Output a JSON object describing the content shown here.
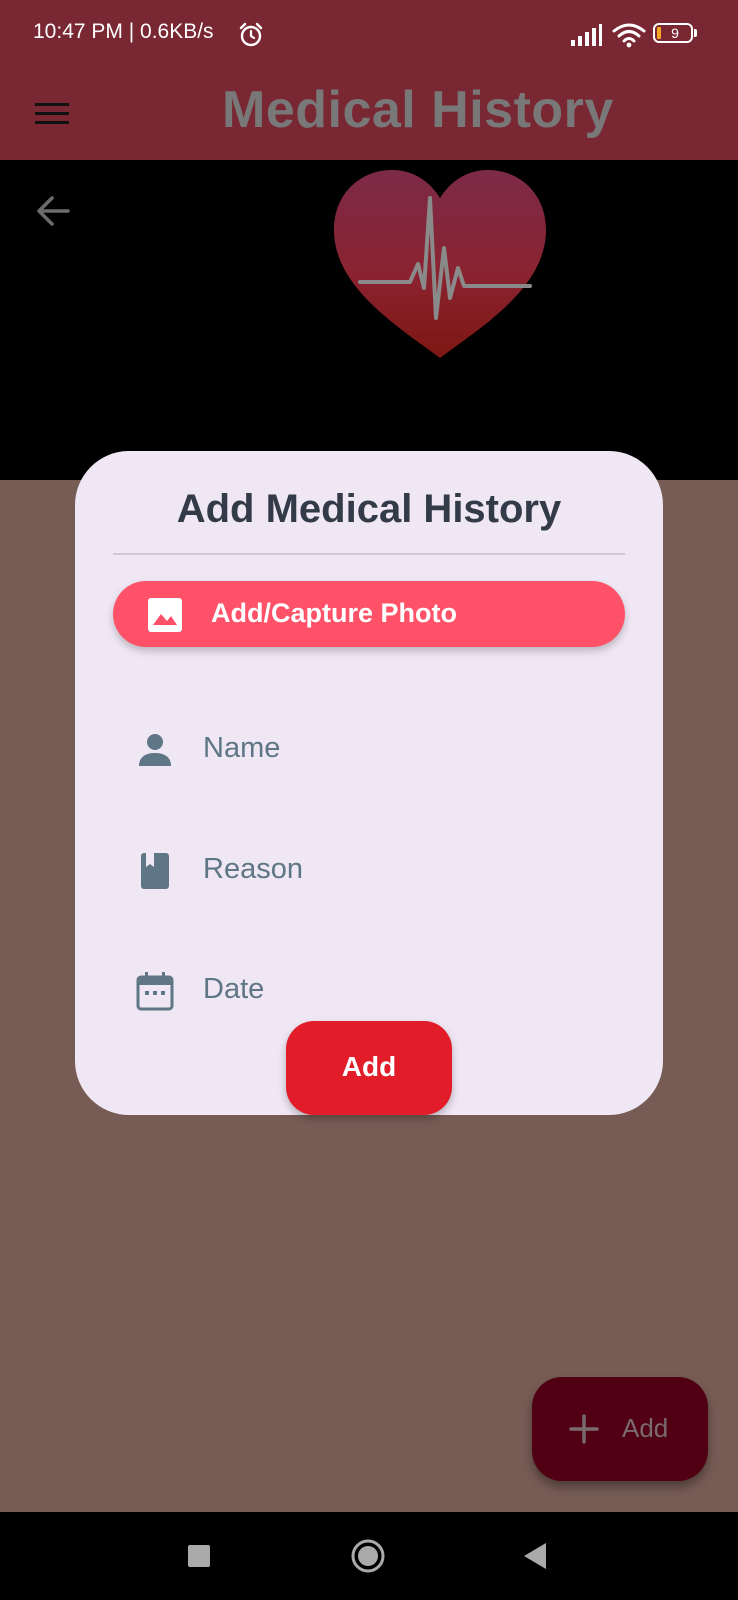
{
  "status_bar": {
    "time_speed": "10:47 PM | 0.6KB/s",
    "battery_level": "9",
    "icons": [
      "alarm-icon",
      "signal-icon",
      "wifi-icon",
      "battery-icon"
    ]
  },
  "app_bar": {
    "title": "Medical History",
    "menu_icon": "menu-icon"
  },
  "hero": {
    "back_icon": "back-arrow-icon",
    "logo": "heart-pulse-logo"
  },
  "dialog": {
    "title": "Add Medical History",
    "photo_button_label": "Add/Capture Photo",
    "fields": [
      {
        "icon": "person-icon",
        "placeholder": "Name"
      },
      {
        "icon": "book-icon",
        "placeholder": "Reason"
      },
      {
        "icon": "calendar-icon",
        "placeholder": "Date"
      }
    ],
    "submit_label": "Add"
  },
  "fab": {
    "label": "Add",
    "icon": "plus-icon"
  },
  "nav_bar": {
    "icons": [
      "recents-icon",
      "home-icon",
      "back-icon"
    ]
  },
  "colors": {
    "app_bar": "#792733",
    "overlay_background": "#775c55",
    "dialog_background": "#efe7f4",
    "photo_button": "#ff5168",
    "submit_button": "#e31c2a",
    "fab": "#500012",
    "field_text": "#5f7686"
  }
}
